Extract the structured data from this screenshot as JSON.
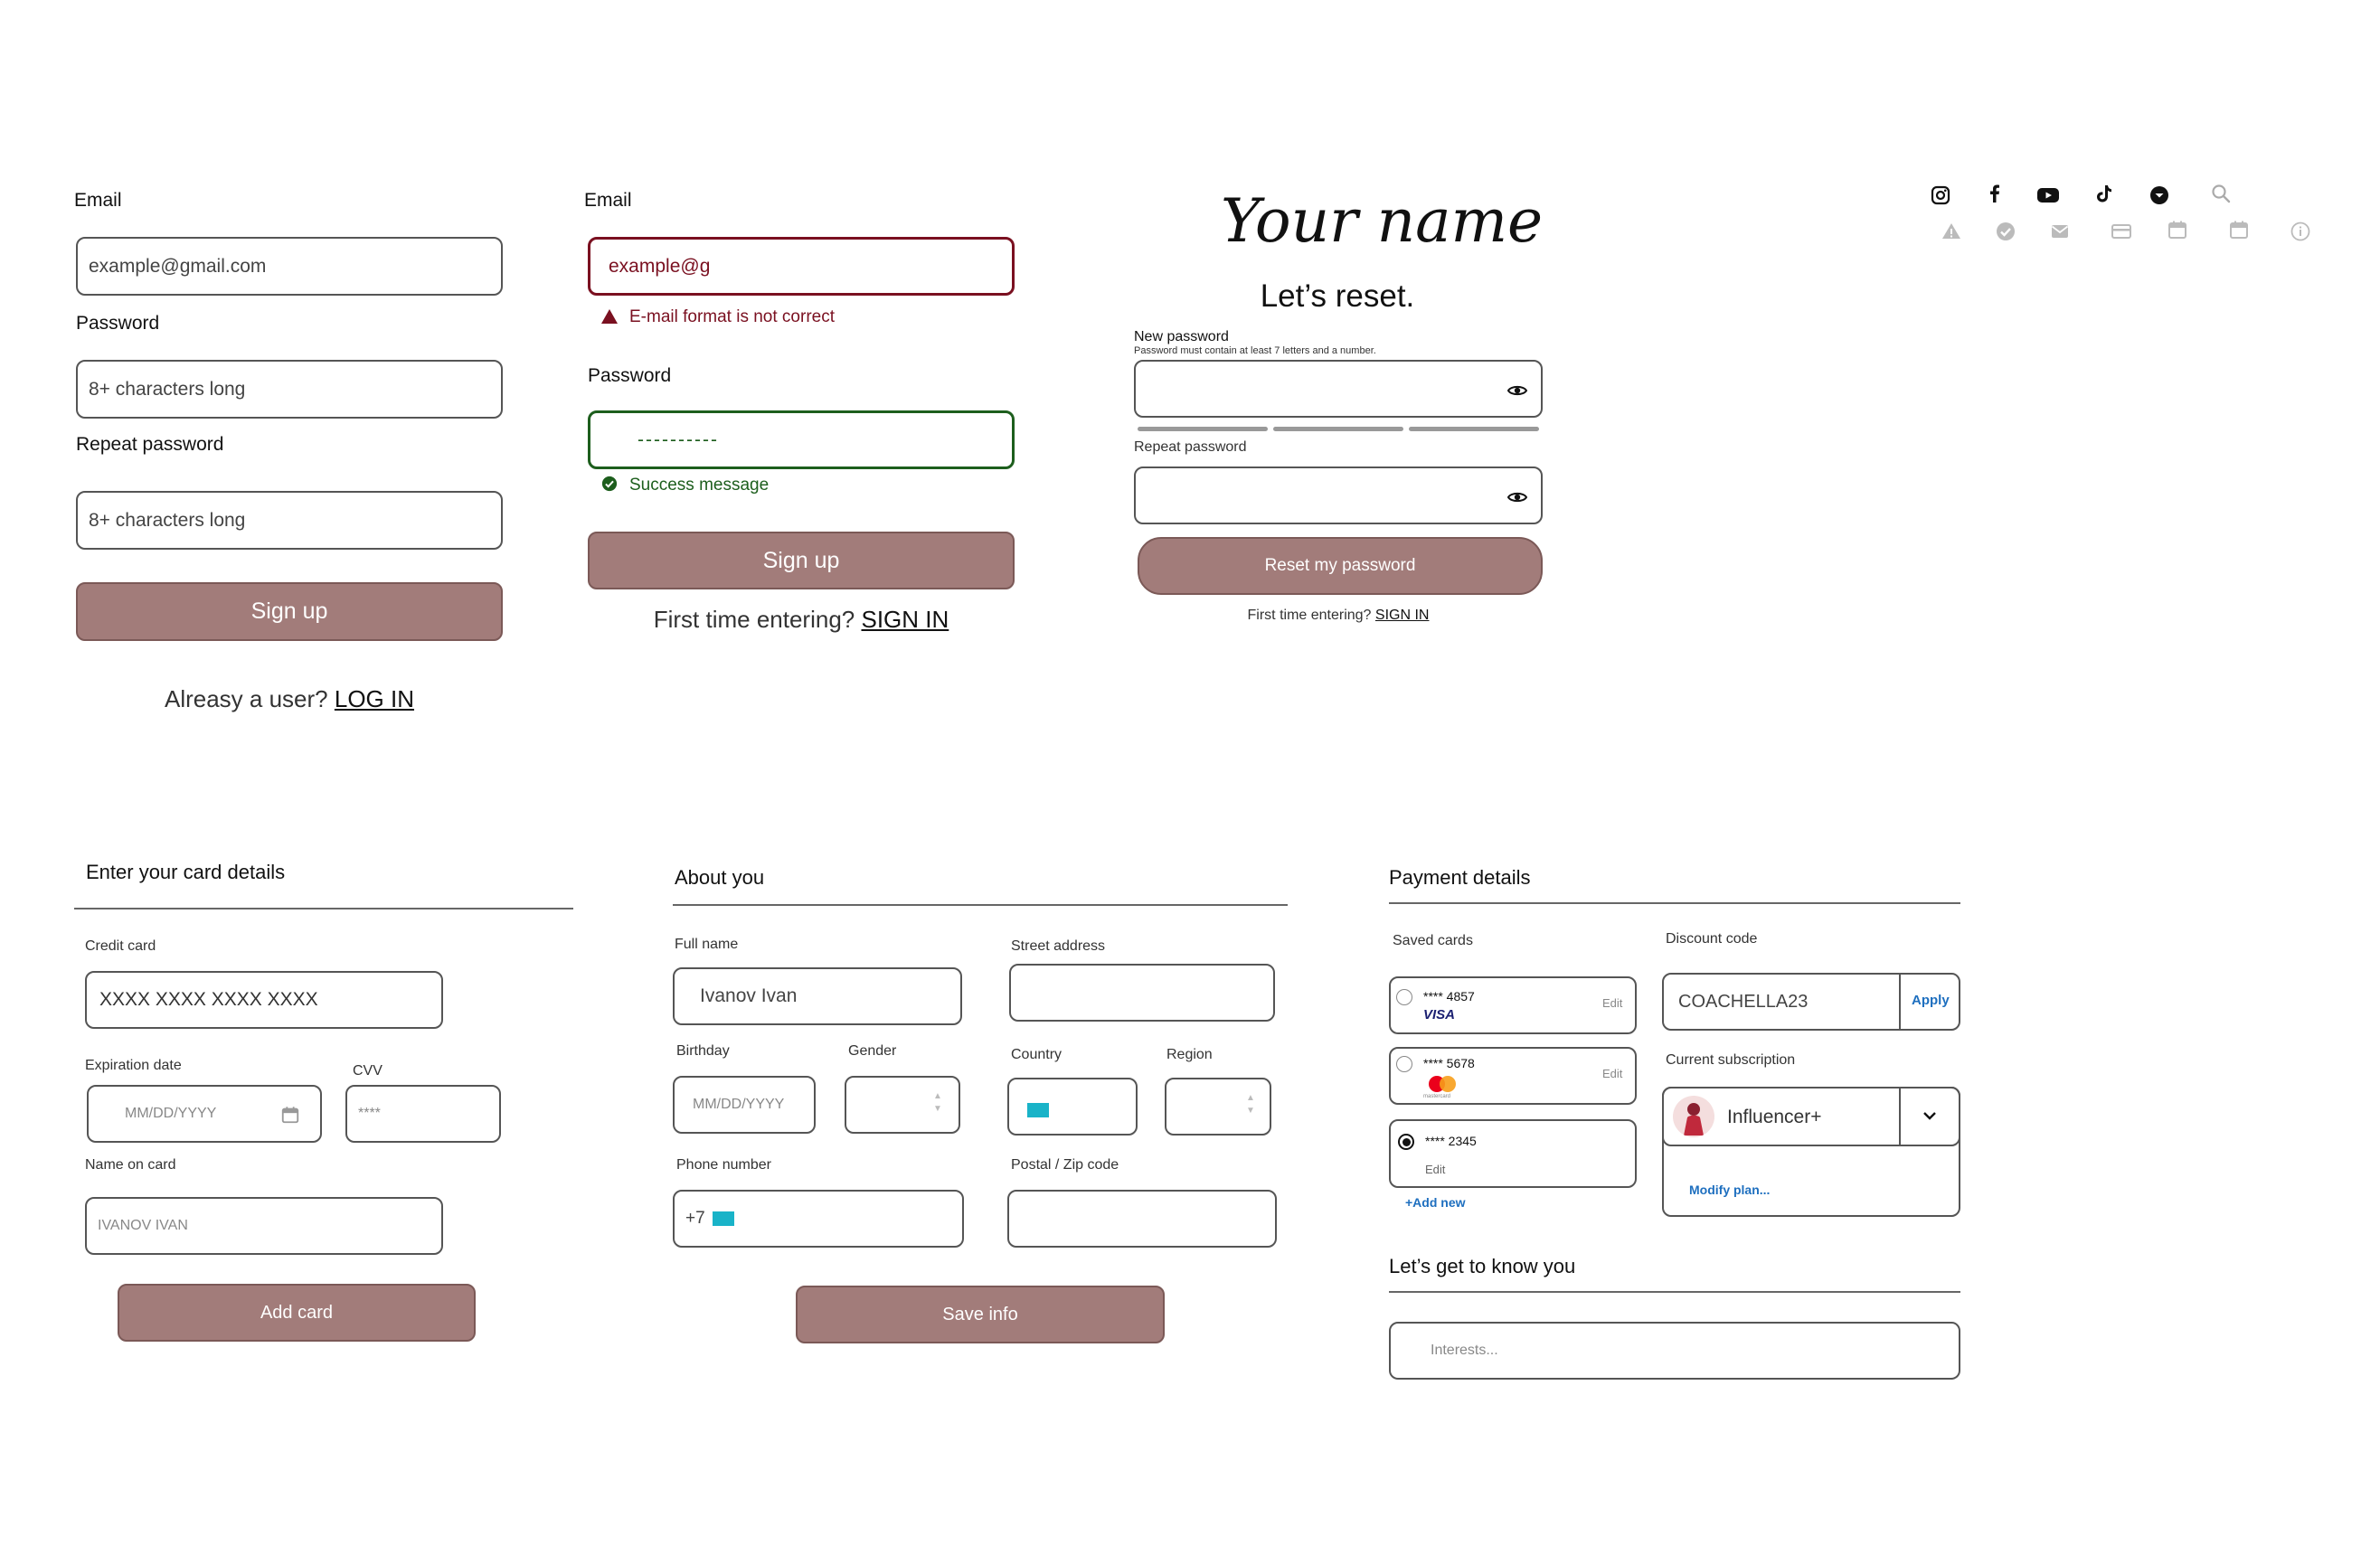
{
  "signup": {
    "email_label": "Email",
    "email_placeholder": "example@gmail.com",
    "password_label": "Password",
    "password_placeholder": "8+ characters long",
    "repeat_label": "Repeat password",
    "repeat_placeholder": "8+ characters long",
    "button": "Sign up",
    "footer_text": "Alreasy a user?",
    "footer_link": "LOG IN"
  },
  "signup_validation": {
    "email_label": "Email",
    "email_value": "example@g",
    "error_message": "E-mail format is not correct",
    "password_label": "Password",
    "password_value": "----------",
    "success_message": "Success message",
    "button": "Sign up",
    "footer_text": "First time entering?",
    "footer_link": "SIGN IN",
    "colors": {
      "error": "#7a1020",
      "success": "#1d5e1d"
    }
  },
  "reset": {
    "logo_text": "Your name",
    "title": "Let’s reset.",
    "new_label": "New password",
    "new_hint": "Password must contain at least 7 letters and a number.",
    "repeat_label": "Repeat password",
    "button": "Reset my password",
    "footer_text": "First time entering?",
    "footer_link": "SIGN IN",
    "strength_segments": 3
  },
  "icons": {
    "row1": [
      "instagram-icon",
      "facebook-icon",
      "youtube-icon",
      "tiktok-icon",
      "chevron-circle-icon",
      "search-icon"
    ],
    "row2": [
      "warning-icon",
      "check-circle-icon",
      "mail-icon",
      "credit-card-icon",
      "calendar-icon",
      "calendar-icon",
      "info-icon"
    ]
  },
  "card": {
    "title": "Enter your card details",
    "credit_label": "Credit card",
    "credit_placeholder": "XXXX XXXX XXXX XXXX",
    "exp_label": "Expiration date",
    "exp_placeholder": "MM/DD/YYYY",
    "cvv_label": "CVV",
    "cvv_placeholder": "****",
    "name_label": "Name on card",
    "name_placeholder": "IVANOV IVAN",
    "button": "Add card"
  },
  "about": {
    "title": "About you",
    "fullname_label": "Full name",
    "fullname_value": "Ivanov Ivan",
    "street_label": "Street address",
    "birthday_label": "Birthday",
    "birthday_placeholder": "MM/DD/YYYY",
    "gender_label": "Gender",
    "country_label": "Country",
    "region_label": "Region",
    "phone_label": "Phone number",
    "phone_prefix": "+7",
    "postal_label": "Postal / Zip code",
    "button": "Save info"
  },
  "payment": {
    "title": "Payment details",
    "saved_label": "Saved cards",
    "cards": [
      {
        "number": "**** 4857",
        "brand": "VISA",
        "edit": "Edit",
        "selected": false
      },
      {
        "number": "**** 5678",
        "brand": "mastercard",
        "edit": "Edit",
        "selected": false
      },
      {
        "number": "**** 2345",
        "brand": "",
        "edit": "Edit",
        "selected": true
      }
    ],
    "add_new": "+Add new",
    "discount_label": "Discount code",
    "discount_value": "COACHELLA23",
    "apply": "Apply",
    "subscription_label": "Current subscription",
    "subscription_value": "Influencer+",
    "modify": "Modify plan...",
    "know_title": "Let’s get to know you",
    "interests_placeholder": "Interests..."
  }
}
